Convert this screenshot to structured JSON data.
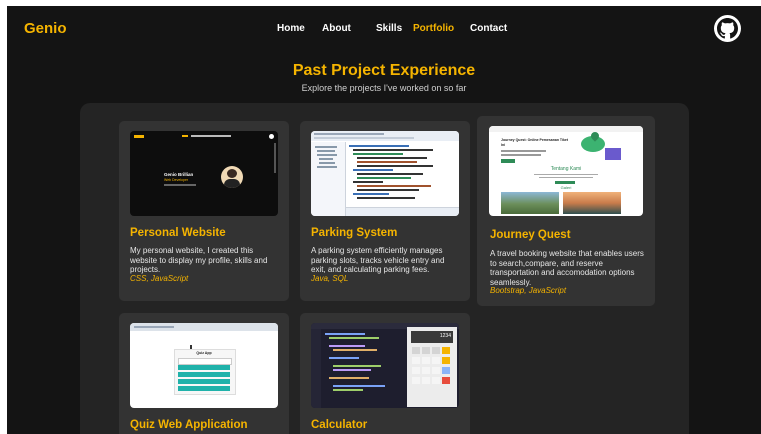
{
  "brand": "Genio",
  "nav": {
    "items": [
      {
        "label": "Home"
      },
      {
        "label": "About"
      },
      {
        "label": "Skills"
      },
      {
        "label": "Portfolio",
        "active": true
      },
      {
        "label": "Contact"
      }
    ]
  },
  "github_icon": "github-icon",
  "section": {
    "title": "Past Project Experience",
    "subtitle": "Explore the projects I've worked on so far"
  },
  "projects": [
    {
      "title": "Personal Website",
      "description": "My personal website, I created this website to display my profile, skills and projects.",
      "tags": "CSS, JavaScript",
      "thumb": {
        "name": "Genio Brillian",
        "role": "Web Developer"
      }
    },
    {
      "title": "Parking System",
      "description": "A parking system efficiently manages parking slots, tracks vehicle entry and exit, and calculating parking fees.",
      "tags": "Java, SQL"
    },
    {
      "title": "Journey Quest",
      "description": "A travel booking website that enables users to search,compare, and reserve transportation and accomodation options seamlessly.",
      "tags": "Bootstrap, JavaScript",
      "thumb": {
        "heading": "Journey Quest: Online Pemesanan Tiket Ini",
        "about": "Tentang Kami",
        "gallery": "Galeri"
      }
    },
    {
      "title": "Quiz Web Application",
      "thumb": {
        "heading": "Quiz App"
      }
    },
    {
      "title": "Calculator",
      "thumb": {
        "display": "1234"
      }
    }
  ],
  "colors": {
    "accent": "#f5b400",
    "background": "#141414",
    "panel": "#242424",
    "card": "#333333"
  }
}
